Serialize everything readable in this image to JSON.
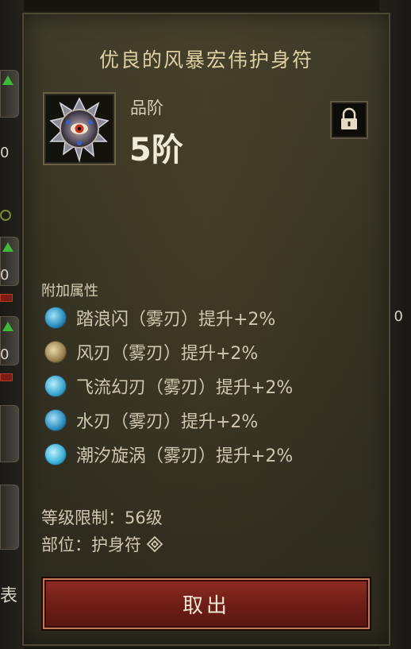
{
  "tooltip": {
    "title": "优良的风暴宏伟护身符",
    "item_icon": "amulet-icon",
    "grade_label": "品阶",
    "grade_value": "5阶",
    "lock_icon": "lock-icon",
    "section_label": "附加属性",
    "attributes": [
      {
        "icon": "skill-wave-dash-icon",
        "text": "踏浪闪（雾刃）提升+2%"
      },
      {
        "icon": "skill-wind-blade-icon",
        "text": "风刃（雾刃）提升+2%"
      },
      {
        "icon": "skill-flowing-blade-icon",
        "text": "飞流幻刃（雾刃）提升+2%"
      },
      {
        "icon": "skill-water-blade-icon",
        "text": "水刃（雾刃）提升+2%"
      },
      {
        "icon": "skill-tide-vortex-icon",
        "text": "潮汐旋涡（雾刃）提升+2%"
      }
    ],
    "level_req": "等级限制：56级",
    "slot": "部位：护身符",
    "slot_icon": "amulet-slot-icon",
    "take_button": "取出"
  },
  "background": {
    "left_values": [
      "0",
      "0",
      "0"
    ],
    "left_text": "表",
    "right_values": [
      "0"
    ]
  },
  "colors": {
    "panel": "#3a3726",
    "title": "#ddd0a3",
    "button": "#7a241b",
    "text": "#cfc7b0"
  }
}
